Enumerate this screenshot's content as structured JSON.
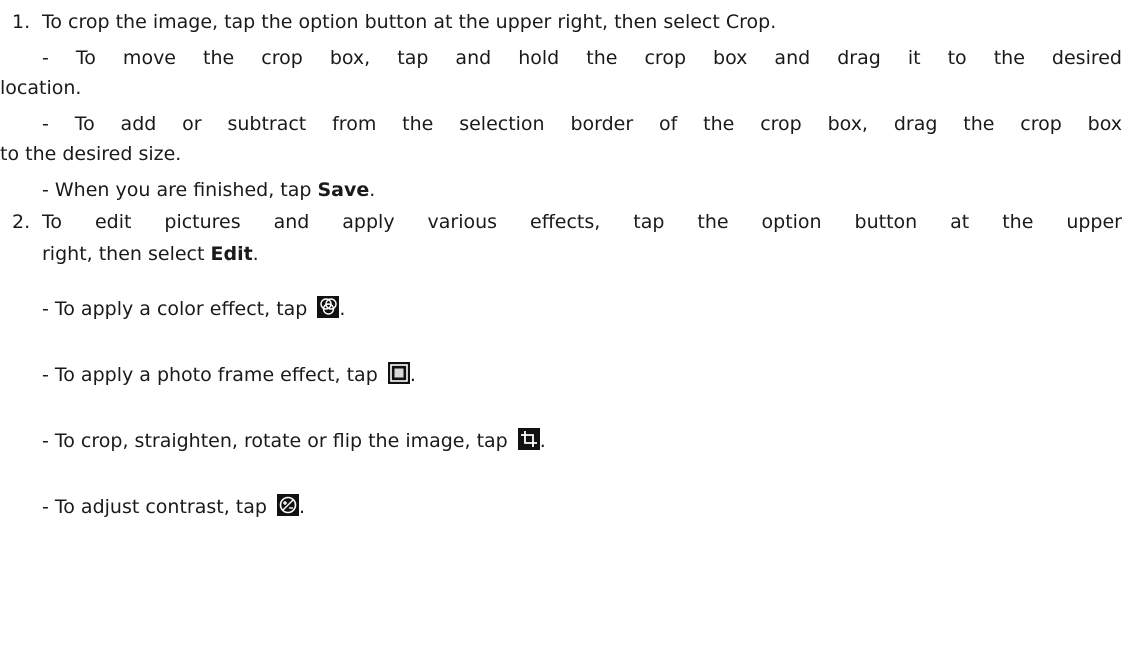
{
  "items": [
    {
      "number": "1.",
      "line1": "To crop the image, tap the option button at the upper right, then select Crop.",
      "sub1a": "- To move the crop box, tap and hold the crop box and drag it to the desired",
      "sub1b": "location.",
      "sub2a": "- To add or subtract from the selection border of the crop box, drag the crop box",
      "sub2b": "to the desired size.",
      "sub3_prefix": "- When you are finished, tap ",
      "sub3_bold": "Save",
      "sub3_suffix": "."
    },
    {
      "number": "2.",
      "line1": "To edit pictures and apply various effects, tap the option button at the upper",
      "line2_prefix": "right, then select ",
      "line2_bold": "Edit",
      "line2_suffix": ".",
      "effects": [
        {
          "text": "- To apply a color effect, tap ",
          "icon": "color-effect-icon",
          "end": "."
        },
        {
          "text": "- To apply a photo frame effect, tap ",
          "icon": "photo-frame-icon",
          "end": "."
        },
        {
          "text": "- To crop, straighten, rotate or flip the image, tap ",
          "icon": "crop-tool-icon",
          "end": "."
        },
        {
          "text": "- To adjust contrast, tap ",
          "icon": "contrast-icon",
          "end": "."
        }
      ]
    }
  ]
}
